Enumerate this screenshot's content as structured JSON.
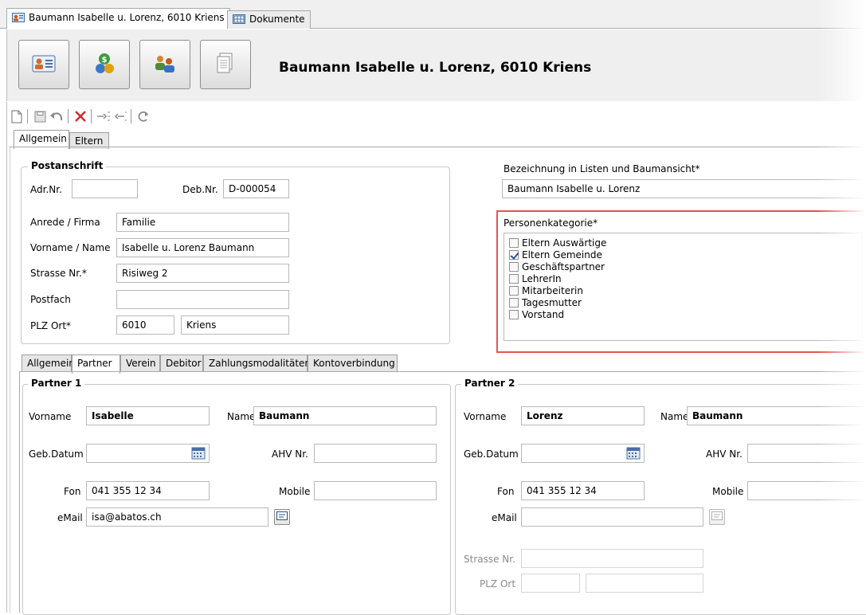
{
  "doc_tabs": [
    {
      "label": "Baumann Isabelle u. Lorenz, 6010 Kriens"
    },
    {
      "label": "Dokumente"
    }
  ],
  "header": {
    "title": "Baumann Isabelle u. Lorenz, 6010 Kriens",
    "buttons": [
      "address-card-icon",
      "money-coins-icon",
      "people-group-icon",
      "documents-icon"
    ]
  },
  "toolbar": {
    "icons": [
      "new-icon",
      "save-icon",
      "undo-icon",
      "delete-icon",
      "move-in-icon",
      "move-out-icon",
      "refresh-icon"
    ]
  },
  "top_tabs": {
    "tab1": "Allgemein",
    "tab2": "Eltern"
  },
  "postanschrift": {
    "title": "Postanschrift",
    "adr_nr_label": "Adr.Nr.",
    "adr_nr_value": "",
    "deb_nr_label": "Deb.Nr.",
    "deb_nr_value": "D-000054",
    "anrede_label": "Anrede / Firma",
    "anrede_value": "Familie",
    "vorname_label": "Vorname / Name",
    "vorname_value": "Isabelle u. Lorenz Baumann",
    "strasse_label": "Strasse Nr.*",
    "strasse_value": "Risiweg 2",
    "postfach_label": "Postfach",
    "postfach_value": "",
    "plz_label": "PLZ Ort*",
    "plz_value": "6010",
    "ort_value": "Kriens"
  },
  "bezeichnung": {
    "label": "Bezeichnung in Listen und Baumansicht*",
    "value": "Baumann Isabelle u. Lorenz"
  },
  "personenkategorie": {
    "label": "Personenkategorie*",
    "items": [
      {
        "label": "Eltern Auswärtige",
        "checked": false
      },
      {
        "label": "Eltern Gemeinde",
        "checked": true
      },
      {
        "label": "Geschäftspartner",
        "checked": false
      },
      {
        "label": "LehrerIn",
        "checked": false
      },
      {
        "label": "Mitarbeiterin",
        "checked": false
      },
      {
        "label": "Tagesmutter",
        "checked": false
      },
      {
        "label": "Vorstand",
        "checked": false
      }
    ]
  },
  "bottom_tabs": [
    "Allgemein",
    "Partner",
    "Verein",
    "Debitor",
    "Zahlungsmodalitäten",
    "Kontoverbindung"
  ],
  "partner1": {
    "title": "Partner 1",
    "vorname_label": "Vorname",
    "vorname_value": "Isabelle",
    "name_label": "Name",
    "name_value": "Baumann",
    "geb_label": "Geb.Datum",
    "geb_value": "",
    "ahv_label": "AHV Nr.",
    "ahv_value": "",
    "fon_label": "Fon",
    "fon_value": "041 355 12 34",
    "mobile_label": "Mobile",
    "mobile_value": "",
    "email_label": "eMail",
    "email_value": "isa@abatos.ch"
  },
  "partner2": {
    "title": "Partner 2",
    "vorname_label": "Vorname",
    "vorname_value": "Lorenz",
    "name_label": "Name",
    "name_value": "Baumann",
    "geb_label": "Geb.Datum",
    "geb_value": "",
    "ahv_label": "AHV Nr.",
    "ahv_value": "",
    "fon_label": "Fon",
    "fon_value": "041 355 12 34",
    "mobile_label": "Mobile",
    "mobile_value": "",
    "email_label": "eMail",
    "email_value": "",
    "strasse_label": "Strasse Nr.",
    "strasse_value": "",
    "plz_label": "PLZ Ort",
    "plz_value": "",
    "ort_value": ""
  },
  "colors": {
    "highlight_border": "#e05555",
    "checkbox_mark": "#2b4f9a"
  }
}
